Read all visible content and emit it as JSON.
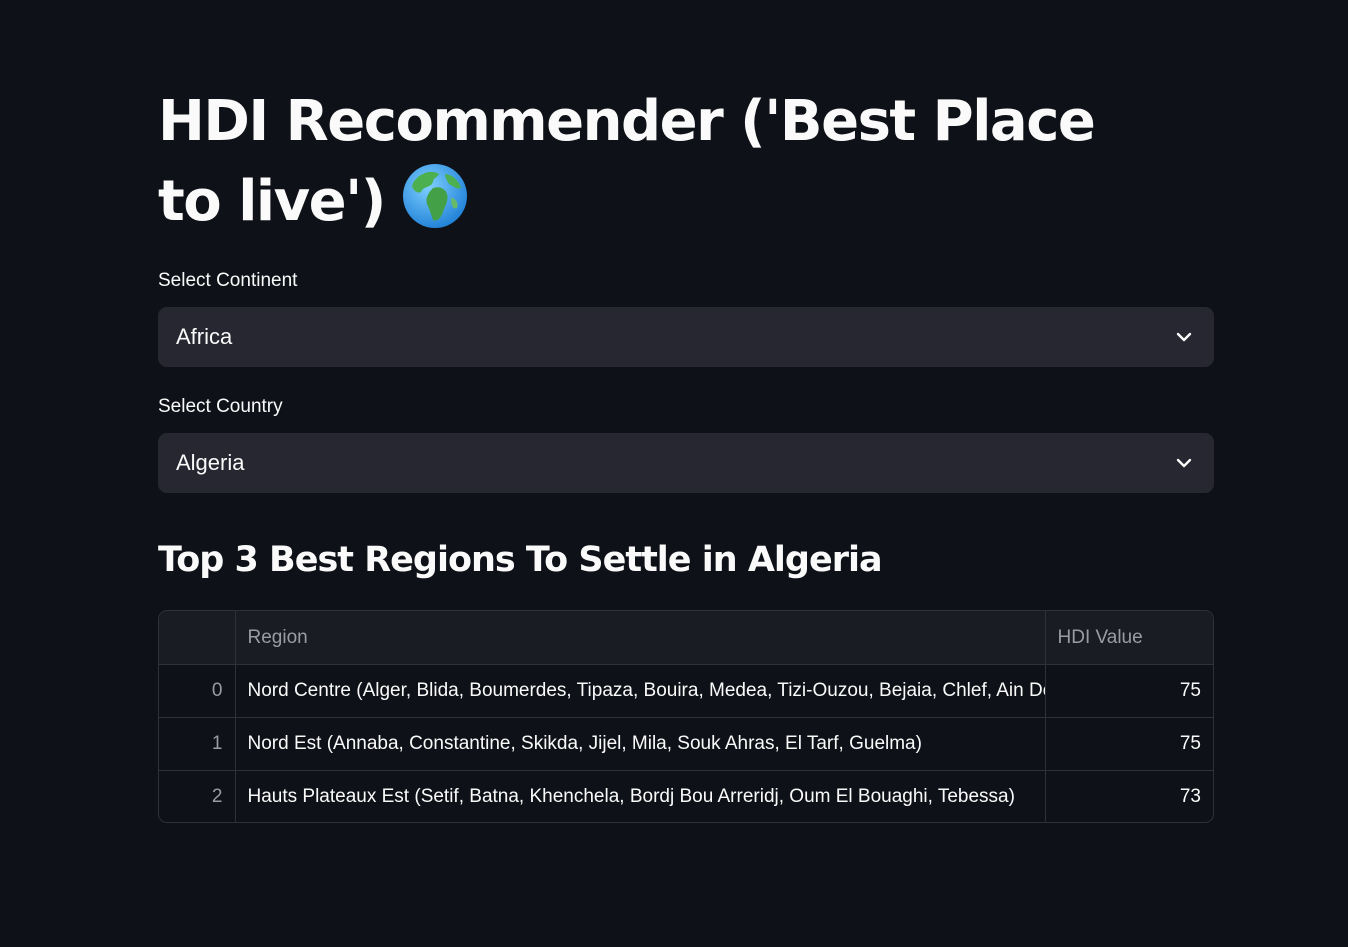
{
  "app": {
    "title": "HDI Recommender ('Best Place to live')",
    "title_icon": "globe-icon"
  },
  "continent": {
    "label": "Select Continent",
    "selected": "Africa"
  },
  "country": {
    "label": "Select Country",
    "selected": "Algeria"
  },
  "results": {
    "heading": "Top 3 Best Regions To Settle in Algeria",
    "columns": [
      "",
      "Region",
      "HDI Value"
    ],
    "rows": [
      {
        "index": "0",
        "region": "Nord Centre (Alger, Blida, Boumerdes, Tipaza, Bouira, Medea, Tizi-Ouzou, Bejaia, Chlef, Ain Defla)",
        "hdi": "75"
      },
      {
        "index": "1",
        "region": "Nord Est (Annaba, Constantine, Skikda, Jijel, Mila, Souk Ahras, El Tarf, Guelma)",
        "hdi": "75"
      },
      {
        "index": "2",
        "region": "Hauts Plateaux Est (Setif, Batna, Khenchela, Bordj Bou Arreridj, Oum El Bouaghi, Tebessa)",
        "hdi": "73"
      }
    ]
  },
  "colors": {
    "background": "#0e1117",
    "widget": "#262730",
    "text": "#fafafa",
    "muted": "#9a9ca5"
  }
}
